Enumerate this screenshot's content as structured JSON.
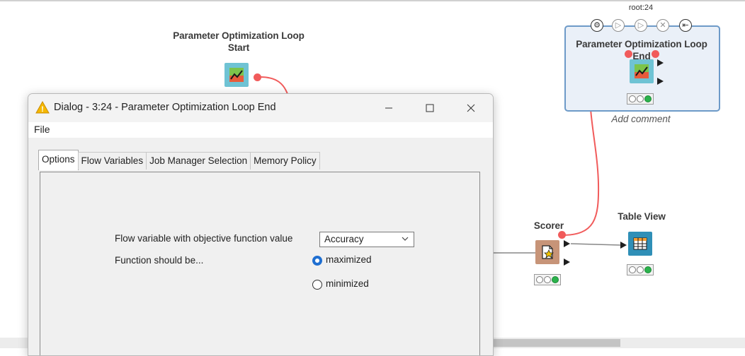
{
  "canvas": {
    "root_label": "root:24",
    "add_comment": "Add comment",
    "nodes": {
      "loop_start": {
        "title_line1": "Parameter Optimization Loop",
        "title_line2": "Start"
      },
      "loop_end": {
        "title": "Parameter Optimization Loop End"
      },
      "scorer": {
        "title": "Scorer"
      },
      "table_view": {
        "title": "Table View"
      }
    },
    "action_icons": [
      "configure-icon",
      "execute-icon",
      "step-icon",
      "cancel-icon",
      "reset-icon"
    ]
  },
  "dialog": {
    "title": "Dialog - 3:24 - Parameter Optimization Loop End",
    "menu": {
      "file": "File"
    },
    "tabs": [
      "Options",
      "Flow Variables",
      "Job Manager Selection",
      "Memory Policy"
    ],
    "active_tab": "Options",
    "form": {
      "objective_label": "Flow variable with objective function value",
      "objective_value": "Accuracy",
      "function_label": "Function should be...",
      "option_max": "maximized",
      "option_min": "minimized",
      "selected": "maximized"
    }
  },
  "colors": {
    "accent_blue": "#1f6fd1",
    "port_red": "#f15b5b",
    "node_teal": "#6fc3d4",
    "scorer_brown": "#c79478",
    "tableview_blue": "#2f8fb7",
    "status_green": "#2bb24c",
    "selection_border": "#6d9ac8"
  }
}
